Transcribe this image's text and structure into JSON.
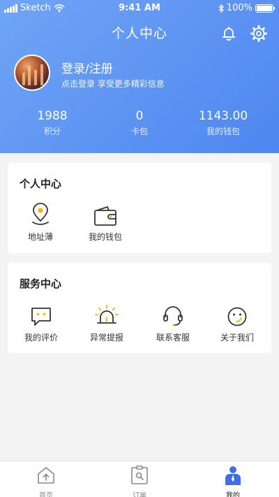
{
  "status_bar": {
    "carrier": "Sketch",
    "time": "9:41 AM",
    "battery": "100%"
  },
  "header": {
    "title": "个人中心"
  },
  "profile": {
    "login_title": "登录/注册",
    "login_subtitle": "点击登录 享受更多精彩信息"
  },
  "stats": [
    {
      "value": "1988",
      "label": "积分"
    },
    {
      "value": "0",
      "label": "卡包"
    },
    {
      "value": "1143.00",
      "label": "我的钱包"
    }
  ],
  "personal_center": {
    "title": "个人中心",
    "items": [
      {
        "label": "地址薄"
      },
      {
        "label": "我的钱包"
      }
    ]
  },
  "service_center": {
    "title": "服务中心",
    "items": [
      {
        "label": "我的评价"
      },
      {
        "label": "异常提报"
      },
      {
        "label": "联系客服"
      },
      {
        "label": "关于我们"
      }
    ]
  },
  "tabbar": {
    "tabs": [
      {
        "label": "首页"
      },
      {
        "label": "订单"
      },
      {
        "label": "我的"
      }
    ],
    "active": "我的"
  },
  "colors": {
    "primary": "#4f86f0",
    "accent": "#f5b400",
    "icon": "#333333"
  }
}
